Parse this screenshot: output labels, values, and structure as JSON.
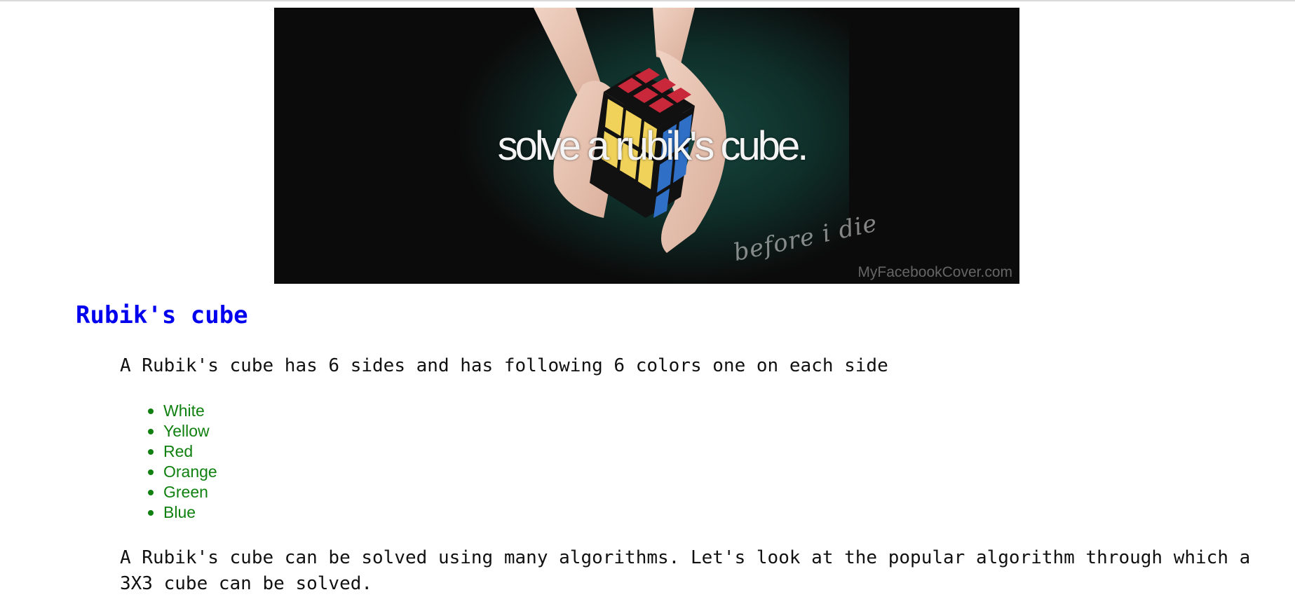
{
  "banner": {
    "caption": "solve a rubik's cube.",
    "tagline": "before i die",
    "watermark": "MyFacebookCover.com"
  },
  "article": {
    "title": "Rubik's cube",
    "intro": "A Rubik's cube has 6 sides and has following 6 colors one on each side",
    "colors": [
      "White",
      "Yellow",
      "Red",
      "Orange",
      "Green",
      "Blue"
    ],
    "outro": "A Rubik's cube can be solved using many algorithms. Let's look at the popular algorithm through which a 3X3 cube can be solved."
  },
  "theme": {
    "title_color": "#0000ee",
    "list_color": "#108010",
    "text_color": "#111111"
  }
}
